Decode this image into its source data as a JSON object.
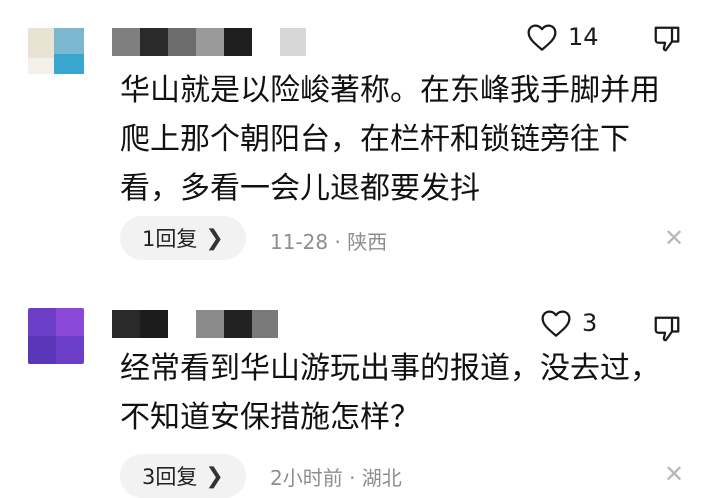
{
  "comments": [
    {
      "likes": "14",
      "text": "华山就是以险峻著称。在东峰我手脚并用爬上那个朝阳台，在栏杆和锁链旁往下看，多看一会儿退都要发抖",
      "replies": "1回复",
      "meta": "11-28 · 陕西"
    },
    {
      "likes": "3",
      "text": "经常看到华山游玩出事的报道，没去过，不知道安保措施怎样？",
      "replies": "3回复",
      "meta": "2小时前 · 湖北"
    }
  ],
  "icons": {
    "like": "heart-icon",
    "dislike": "thumbs-down-icon",
    "chevron": "chevron-right-icon",
    "close": "close-icon"
  }
}
